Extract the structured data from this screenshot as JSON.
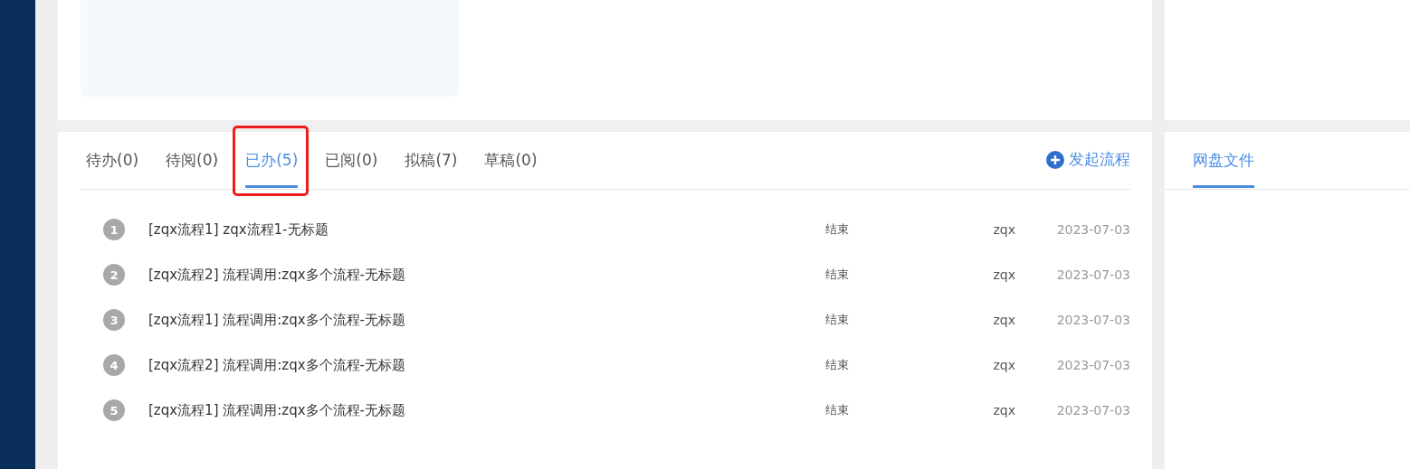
{
  "tabs": [
    {
      "label": "待办(0)",
      "selected": false,
      "highlighted": false
    },
    {
      "label": "待阅(0)",
      "selected": false,
      "highlighted": false
    },
    {
      "label": "已办(5)",
      "selected": true,
      "highlighted": true
    },
    {
      "label": "已阅(0)",
      "selected": false,
      "highlighted": false
    },
    {
      "label": "拟稿(7)",
      "selected": false,
      "highlighted": false
    },
    {
      "label": "草稿(0)",
      "selected": false,
      "highlighted": false
    }
  ],
  "start_flow": {
    "label": "发起流程"
  },
  "rows": [
    {
      "index": "1",
      "title": "[zqx流程1] zqx流程1-无标题",
      "status": "结束",
      "user": "zqx",
      "date": "2023-07-03"
    },
    {
      "index": "2",
      "title": "[zqx流程2] 流程调用:zqx多个流程-无标题",
      "status": "结束",
      "user": "zqx",
      "date": "2023-07-03"
    },
    {
      "index": "3",
      "title": "[zqx流程1] 流程调用:zqx多个流程-无标题",
      "status": "结束",
      "user": "zqx",
      "date": "2023-07-03"
    },
    {
      "index": "4",
      "title": "[zqx流程2] 流程调用:zqx多个流程-无标题",
      "status": "结束",
      "user": "zqx",
      "date": "2023-07-03"
    },
    {
      "index": "5",
      "title": "[zqx流程1] 流程调用:zqx多个流程-无标题",
      "status": "结束",
      "user": "zqx",
      "date": "2023-07-03"
    }
  ],
  "side_tabs": [
    {
      "label": "网盘文件",
      "selected": true
    }
  ]
}
